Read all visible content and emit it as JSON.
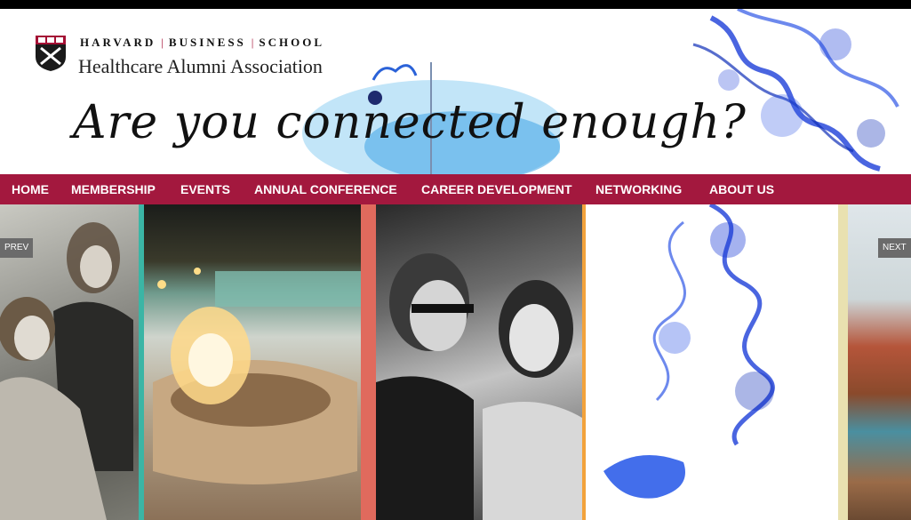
{
  "header": {
    "school_words": [
      "HARVARD",
      "BUSINESS",
      "SCHOOL"
    ],
    "association": "Healthcare Alumni Association",
    "tagline": "Are you connected enough?"
  },
  "nav": {
    "items": [
      {
        "label": "HOME"
      },
      {
        "label": "MEMBERSHIP"
      },
      {
        "label": "EVENTS"
      },
      {
        "label": "ANNUAL CONFERENCE"
      },
      {
        "label": "CAREER DEVELOPMENT"
      },
      {
        "label": "NETWORKING"
      },
      {
        "label": "ABOUT US"
      }
    ]
  },
  "gallery": {
    "prev_label": "PREV",
    "next_label": "NEXT"
  },
  "colors": {
    "nav_bg": "#a3183e",
    "brand_crimson": "#a41034",
    "ink_blue": "#1d3fd8",
    "divider_teal": "#3bb5a5",
    "divider_coral": "#e06a5d",
    "divider_orange": "#f2a23c",
    "divider_cream": "#e9e1b0"
  }
}
